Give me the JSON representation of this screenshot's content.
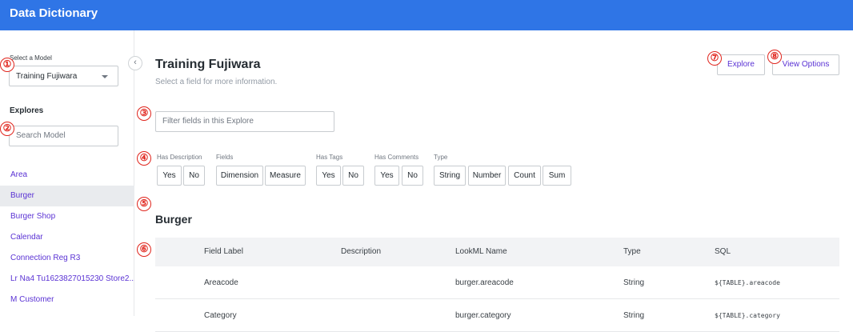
{
  "app": {
    "title": "Data Dictionary"
  },
  "sidebar": {
    "model_label": "Select a Model",
    "model_value": "Training Fujiwara",
    "explores_heading": "Explores",
    "search_placeholder": "Search Model",
    "items": [
      {
        "label": "Area"
      },
      {
        "label": "Burger"
      },
      {
        "label": "Burger Shop"
      },
      {
        "label": "Calendar"
      },
      {
        "label": "Connection Reg R3"
      },
      {
        "label": "Lr Na4 Tu1623827015230 Store2..."
      },
      {
        "label": "M Customer"
      }
    ],
    "active_item": "Burger"
  },
  "header": {
    "title": "Training Fujiwara",
    "subtitle": "Select a field for more information.",
    "explore_button": "Explore",
    "view_options_button": "View Options"
  },
  "filter": {
    "placeholder": "Filter fields in this Explore"
  },
  "filter_groups": {
    "has_description": {
      "label": "Has Description",
      "options": [
        "Yes",
        "No"
      ]
    },
    "fields": {
      "label": "Fields",
      "options": [
        "Dimension",
        "Measure"
      ]
    },
    "has_tags": {
      "label": "Has Tags",
      "options": [
        "Yes",
        "No"
      ]
    },
    "has_comments": {
      "label": "Has Comments",
      "options": [
        "Yes",
        "No"
      ]
    },
    "type": {
      "label": "Type",
      "options": [
        "String",
        "Number",
        "Count",
        "Sum"
      ]
    }
  },
  "section": {
    "title": "Burger"
  },
  "table": {
    "headers": [
      "Field Label",
      "Description",
      "LookML Name",
      "Type",
      "SQL"
    ],
    "rows": [
      [
        "Areacode",
        "",
        "burger.areacode",
        "String",
        "${TABLE}.areacode"
      ],
      [
        "Category",
        "",
        "burger.category",
        "String",
        "${TABLE}.category"
      ]
    ]
  },
  "markers": [
    "①",
    "②",
    "③",
    "④",
    "⑤",
    "⑥",
    "⑦",
    "⑧"
  ],
  "colors": {
    "topbar": "#2f75e6",
    "link": "#5a32d4",
    "marker": "#e0241c"
  }
}
